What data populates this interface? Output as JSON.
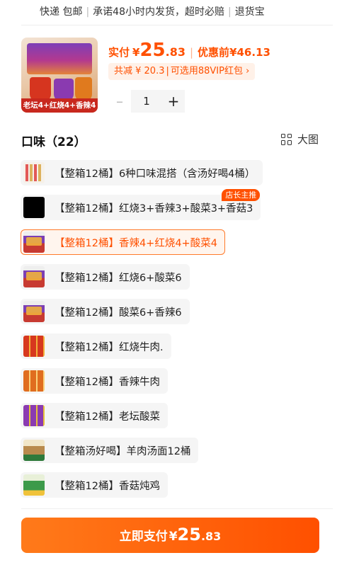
{
  "shipping": {
    "express": "快递 包邮",
    "promise": "承诺48小时内发货，超时必赔",
    "guarantee": "退货宝"
  },
  "product": {
    "image_caption": "老坛4+红烧4+香辣4"
  },
  "price": {
    "paid_label": "实付",
    "currency": "¥",
    "paid_int": "25",
    "paid_dec": ".83",
    "pre_label": "优惠前",
    "pre_value": "¥46.13",
    "discount_text": "共减 ¥ 20.3",
    "vip_text": "可选用88VIP红包",
    "chevron": "›",
    "accent_color": "#ff5000"
  },
  "quantity": {
    "minus": "–",
    "value": "1",
    "plus": "+"
  },
  "flavor": {
    "title": "口味（22）",
    "view_label": "大图",
    "options": [
      {
        "label": "【整箱12桶】6种口味混搭（含汤好喝4桶）"
      },
      {
        "label": "【整箱12桶】红烧3+香辣3+酸菜3+香菇3",
        "badge": "店长主推"
      },
      {
        "label": "【整箱12桶】香辣4+红烧4+酸菜4",
        "selected": true
      },
      {
        "label": "【整箱12桶】红烧6+酸菜6"
      },
      {
        "label": "【整箱12桶】酸菜6+香辣6"
      },
      {
        "label": "【整箱12桶】红烧牛肉."
      },
      {
        "label": "【整箱12桶】香辣牛肉"
      },
      {
        "label": "【整箱12桶】老坛酸菜"
      },
      {
        "label": "【整箱汤好喝】羊肉汤面12桶"
      },
      {
        "label": "【整箱12桶】香菇炖鸡"
      }
    ]
  },
  "pay_button": {
    "label": "立即支付",
    "currency": "¥",
    "int": "25",
    "dec": ".83"
  }
}
